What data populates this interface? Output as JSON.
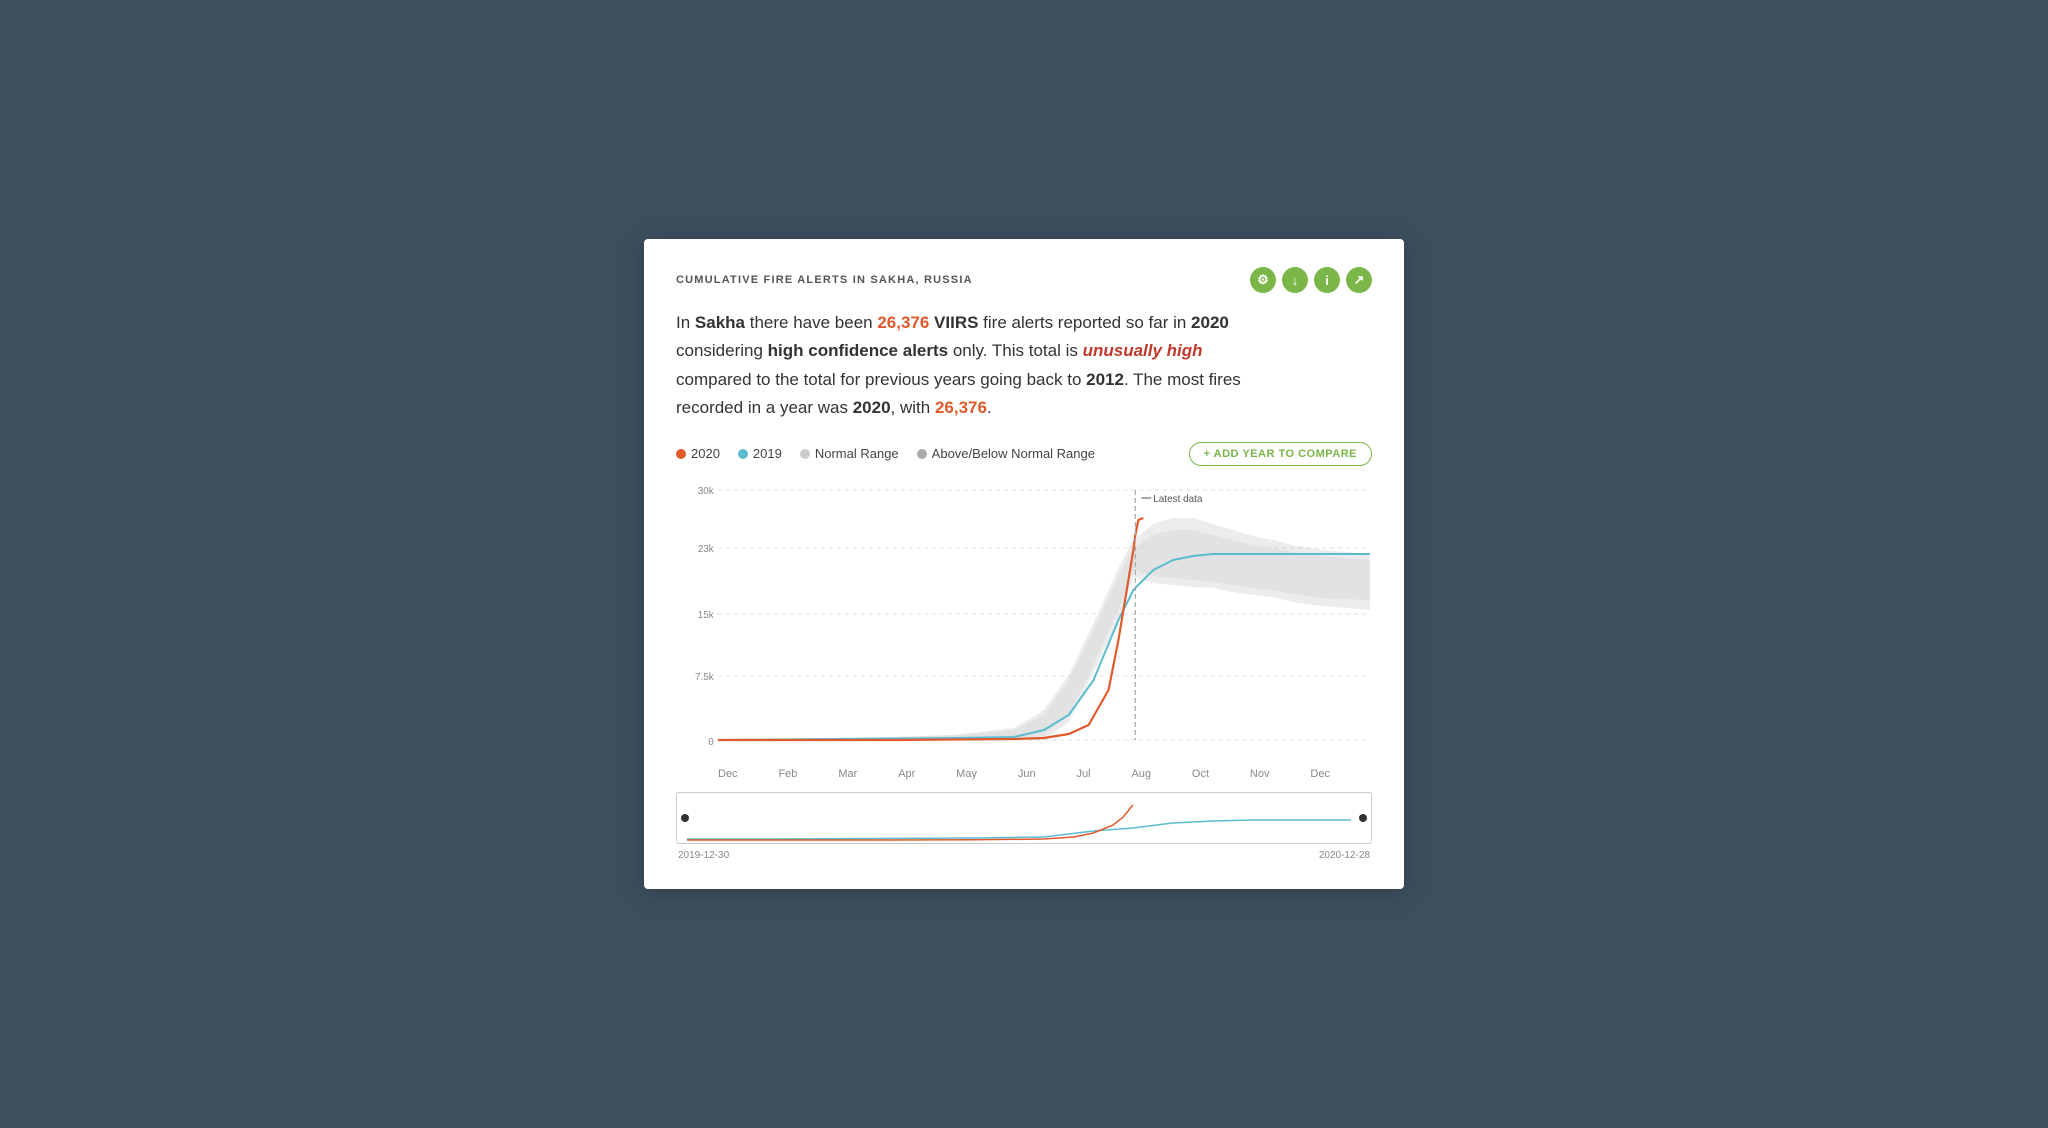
{
  "card": {
    "title": "CUMULATIVE FIRE ALERTS IN SAKHA, RUSSIA",
    "description": {
      "intro": "In ",
      "location": "Sakha",
      "mid1": " there have been ",
      "alert_count": "26,376",
      "mid2": " VIIRS",
      "mid3": " fire alerts reported so far in ",
      "year": "2020",
      "mid4": " considering ",
      "confidence": "high confidence alerts",
      "mid5": " only. This total is ",
      "status": "unusually high",
      "mid6": " compared to the total for previous years going back to ",
      "start_year": "2012",
      "mid7": ". The most fires recorded in a year was ",
      "max_year": "2020",
      "mid8": ", with ",
      "max_count": "26,376",
      "end": "."
    },
    "legend": {
      "year2020": "2020",
      "year2019": "2019",
      "normal_range": "Normal Range",
      "above_below": "Above/Below Normal Range",
      "add_year_btn": "+ ADD YEAR TO COMPARE"
    },
    "chart": {
      "y_labels": [
        "30k",
        "23k",
        "15k",
        "7.5k",
        "0"
      ],
      "x_labels": [
        "Dec",
        "Feb",
        "Mar",
        "Apr",
        "May",
        "Jun",
        "Jul",
        "Aug",
        "Oct",
        "Nov",
        "Dec"
      ],
      "latest_data_label": "Latest data"
    },
    "minimap": {
      "start_date": "2019-12-30",
      "end_date": "2020-12-28"
    },
    "header_icons": [
      {
        "name": "settings-icon",
        "symbol": "⚙"
      },
      {
        "name": "download-icon",
        "symbol": "↓"
      },
      {
        "name": "info-icon",
        "symbol": "i"
      },
      {
        "name": "share-icon",
        "symbol": "↗"
      }
    ]
  }
}
